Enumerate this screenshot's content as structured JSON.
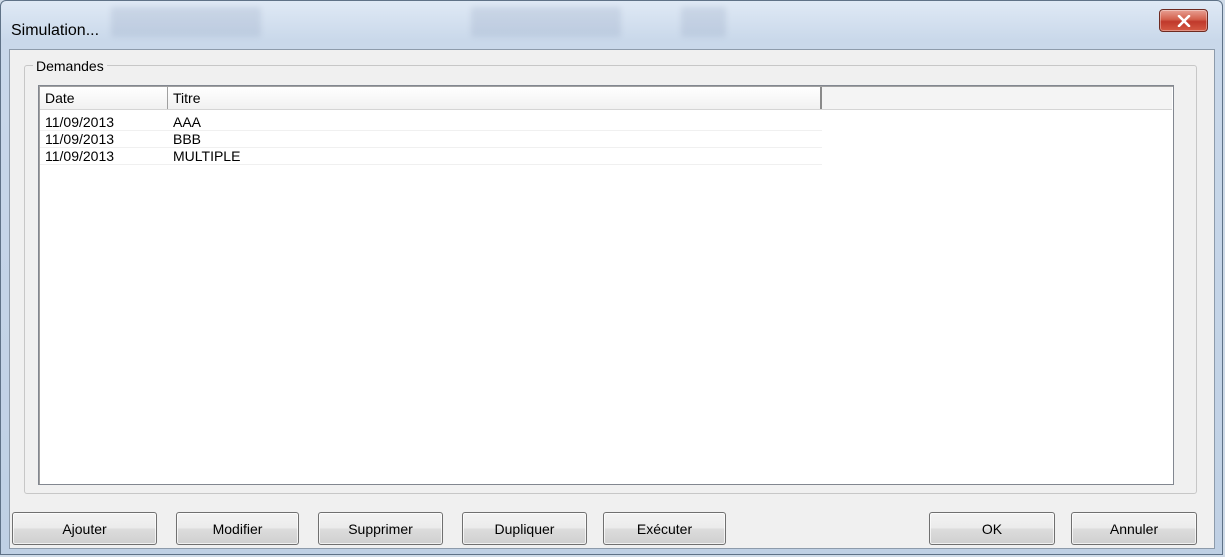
{
  "window": {
    "title": "Simulation..."
  },
  "groupbox": {
    "label": "Demandes"
  },
  "list": {
    "columns": [
      {
        "label": "Date"
      },
      {
        "label": "Titre"
      }
    ],
    "rows": [
      {
        "date": "11/09/2013",
        "titre": "AAA"
      },
      {
        "date": "11/09/2013",
        "titre": "BBB"
      },
      {
        "date": "11/09/2013",
        "titre": "MULTIPLE"
      }
    ]
  },
  "buttons": {
    "ajouter": "Ajouter",
    "modifier": "Modifier",
    "supprimer": "Supprimer",
    "dupliquer": "Dupliquer",
    "executer": "Exécuter",
    "ok": "OK",
    "annuler": "Annuler"
  },
  "icons": {
    "close": "close-icon"
  },
  "colors": {
    "close_button": "#c0392b",
    "client_background": "#f0f0f0"
  }
}
